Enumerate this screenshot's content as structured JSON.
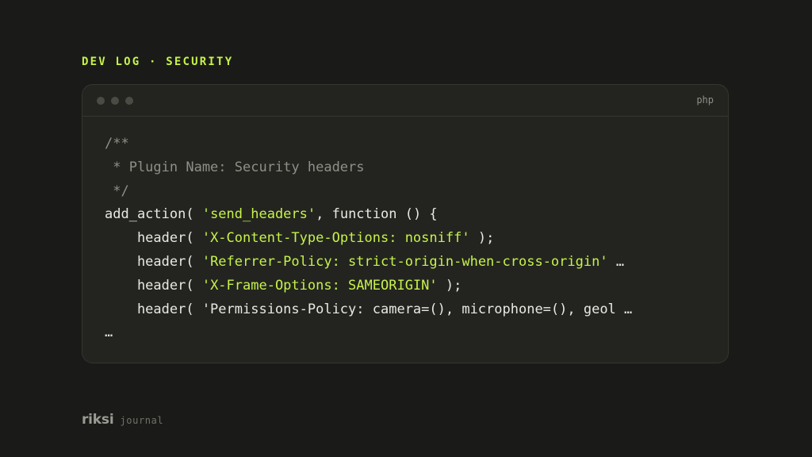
{
  "eyebrow": "DEV LOG · SECURITY",
  "window": {
    "language": "php",
    "dots": [
      "window-dot-1",
      "window-dot-2",
      "window-dot-3"
    ]
  },
  "code": {
    "lines": [
      [
        {
          "t": "c",
          "v": "/**"
        }
      ],
      [
        {
          "t": "c",
          "v": " * Plugin Name: Security headers"
        }
      ],
      [
        {
          "t": "c",
          "v": " */"
        }
      ],
      [
        {
          "t": "p",
          "v": "add_action( "
        },
        {
          "t": "s",
          "v": "'send_headers'"
        },
        {
          "t": "p",
          "v": ", function () {"
        }
      ],
      [
        {
          "t": "p",
          "v": "    header( "
        },
        {
          "t": "s",
          "v": "'X-Content-Type-Options: nosniff'"
        },
        {
          "t": "p",
          "v": " );"
        }
      ],
      [
        {
          "t": "p",
          "v": "    header( "
        },
        {
          "t": "s",
          "v": "'Referrer-Policy: strict-origin-when-cross-origin'"
        },
        {
          "t": "p",
          "v": " …"
        }
      ],
      [
        {
          "t": "p",
          "v": "    header( "
        },
        {
          "t": "s",
          "v": "'X-Frame-Options: SAMEORIGIN'"
        },
        {
          "t": "p",
          "v": " );"
        }
      ],
      [
        {
          "t": "p",
          "v": "    header( 'Permissions-Policy: camera=(), microphone=(), geol …"
        }
      ],
      [
        {
          "t": "p",
          "v": "…"
        }
      ]
    ]
  },
  "footer": {
    "brand": "riksi",
    "subtitle": "journal"
  },
  "colors": {
    "background": "#1a1b18",
    "panel": "#232420",
    "accent": "#c6f24a",
    "comment": "#8e9086",
    "text": "#e8e9e1"
  }
}
